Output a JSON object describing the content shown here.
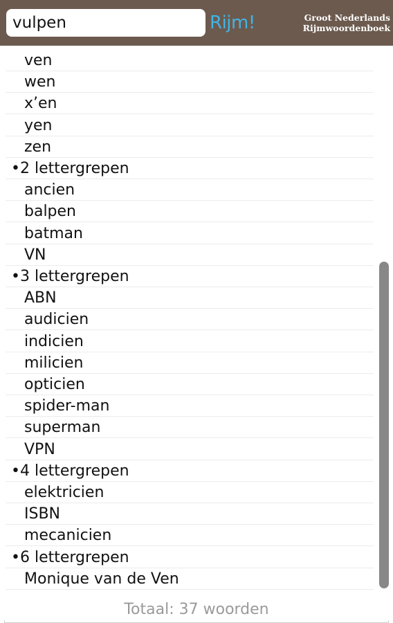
{
  "search": {
    "value": "vulpen"
  },
  "action": {
    "label": "Rijm!",
    "color": "#41b4e6"
  },
  "brand": {
    "line1": "Groot Nederlands",
    "line2": "Rijmwoordenboek"
  },
  "header_color": "#6c5a4e",
  "results": [
    {
      "text": "ven",
      "group": false
    },
    {
      "text": "wen",
      "group": false
    },
    {
      "text": "x’en",
      "group": false
    },
    {
      "text": "yen",
      "group": false
    },
    {
      "text": "zen",
      "group": false
    },
    {
      "text": "•2 lettergrepen",
      "group": true
    },
    {
      "text": "ancien",
      "group": false
    },
    {
      "text": "balpen",
      "group": false
    },
    {
      "text": "batman",
      "group": false
    },
    {
      "text": "VN",
      "group": false
    },
    {
      "text": "•3 lettergrepen",
      "group": true
    },
    {
      "text": "ABN",
      "group": false
    },
    {
      "text": "audicien",
      "group": false
    },
    {
      "text": "indicien",
      "group": false
    },
    {
      "text": "milicien",
      "group": false
    },
    {
      "text": "opticien",
      "group": false
    },
    {
      "text": "spider-man",
      "group": false
    },
    {
      "text": "superman",
      "group": false
    },
    {
      "text": "VPN",
      "group": false
    },
    {
      "text": "•4 lettergrepen",
      "group": true
    },
    {
      "text": "elektricien",
      "group": false
    },
    {
      "text": "ISBN",
      "group": false
    },
    {
      "text": "mecanicien",
      "group": false
    },
    {
      "text": "•6 lettergrepen",
      "group": true
    },
    {
      "text": "Monique van de Ven",
      "group": false
    }
  ],
  "footer": {
    "total": "Totaal: 37 woorden"
  }
}
